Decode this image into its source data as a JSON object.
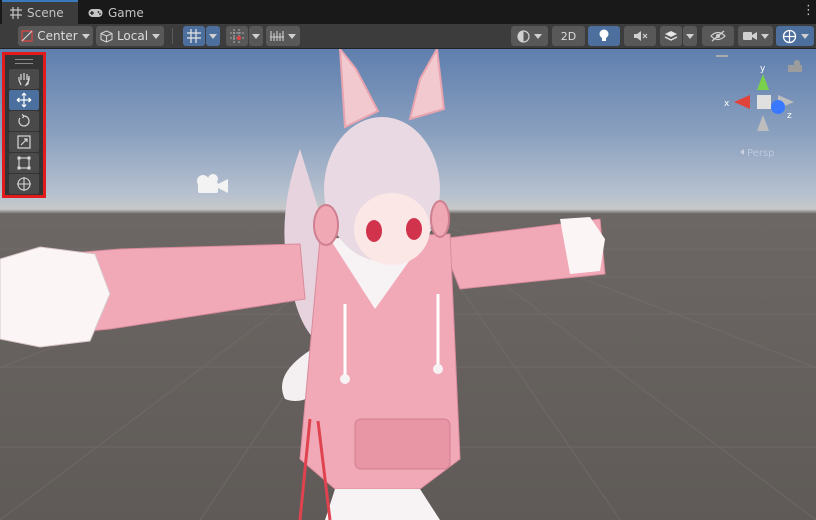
{
  "tabs": [
    {
      "label": "Scene",
      "icon": "grid-icon",
      "active": true
    },
    {
      "label": "Game",
      "icon": "gamepad-icon",
      "active": false
    }
  ],
  "toolbar": {
    "pivot_label": "Center",
    "space_label": "Local",
    "mode_2d_label": "2D"
  },
  "tools": [
    {
      "name": "hand",
      "icon": "hand-icon"
    },
    {
      "name": "move",
      "icon": "move-icon",
      "active": true
    },
    {
      "name": "rotate",
      "icon": "rotate-icon"
    },
    {
      "name": "scale",
      "icon": "scale-icon"
    },
    {
      "name": "rect",
      "icon": "rect-icon"
    },
    {
      "name": "transform",
      "icon": "transform-icon"
    }
  ],
  "gizmo": {
    "axes": [
      "y",
      "x",
      "z"
    ],
    "projection_label": "Persp"
  },
  "colors": {
    "highlight": "#e21c1c",
    "accent": "#3a79bb",
    "toggle_on": "#4c6f9e"
  }
}
